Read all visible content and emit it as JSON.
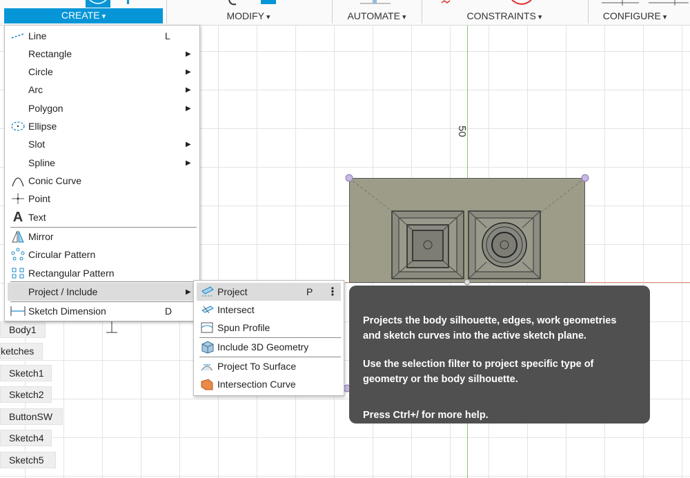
{
  "toolbar": {
    "create_label": "CREATE",
    "modify_label": "MODIFY",
    "automate_label": "AUTOMATE",
    "constraints_label": "CONSTRAINTS",
    "configure_label": "CONFIGURE"
  },
  "browser": {
    "items": [
      "Body1",
      "ketches",
      "Sketch1",
      "Sketch2",
      "ButtonSW",
      "Sketch4",
      "Sketch5"
    ]
  },
  "canvas": {
    "dimension_label": "50"
  },
  "create_menu": {
    "items": [
      {
        "label": "Line",
        "shortcut": "L",
        "icon": "line-icon"
      },
      {
        "label": "Rectangle",
        "submenu": true
      },
      {
        "label": "Circle",
        "submenu": true
      },
      {
        "label": "Arc",
        "submenu": true
      },
      {
        "label": "Polygon",
        "submenu": true
      },
      {
        "label": "Ellipse",
        "icon": "ellipse-icon"
      },
      {
        "label": "Slot",
        "submenu": true
      },
      {
        "label": "Spline",
        "submenu": true
      },
      {
        "label": "Conic Curve",
        "icon": "conic-curve-icon"
      },
      {
        "label": "Point",
        "icon": "point-icon"
      },
      {
        "label": "Text",
        "icon": "text-icon"
      },
      {
        "label": "Mirror",
        "icon": "mirror-icon"
      },
      {
        "label": "Circular Pattern",
        "icon": "circular-pattern-icon"
      },
      {
        "label": "Rectangular Pattern",
        "icon": "rectangular-pattern-icon"
      },
      {
        "label": "Project / Include",
        "submenu": true
      },
      {
        "label": "Sketch Dimension",
        "shortcut": "D",
        "icon": "sketch-dimension-icon"
      }
    ]
  },
  "project_menu": {
    "items": [
      {
        "label": "Project",
        "shortcut": "P",
        "icon": "project-icon"
      },
      {
        "label": "Intersect",
        "icon": "intersect-icon"
      },
      {
        "label": "Spun Profile",
        "icon": "spun-profile-icon"
      },
      {
        "label": "Include 3D Geometry",
        "icon": "include-3d-geometry-icon"
      },
      {
        "label": "Project To Surface",
        "icon": "project-to-surface-icon"
      },
      {
        "label": "Intersection Curve",
        "icon": "intersection-curve-icon"
      }
    ]
  },
  "tooltip": {
    "line1": "Projects the body silhouette, edges, work geometries and sketch curves into the active sketch plane.",
    "line2": "Use the selection filter to project specific type of geometry or the body silhouette.",
    "line3": "Press Ctrl+/ for more help."
  },
  "colors": {
    "accent": "#0696d7",
    "tooltip_bg": "#505050",
    "body_fill": "#9c9c88"
  }
}
